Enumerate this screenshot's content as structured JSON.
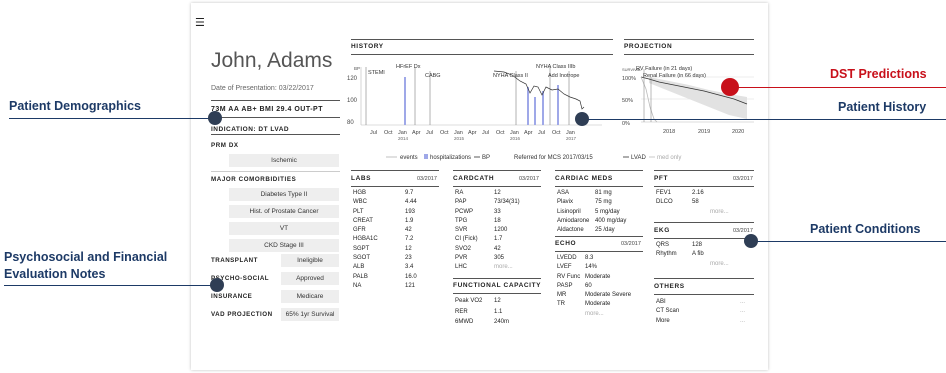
{
  "menu_icon": "hamburger-menu-icon",
  "patient": {
    "name": "John, Adams",
    "presentation_date": "Date of Presentation: 03/22/2017",
    "demographics": "73M  AA  AB+  BMI 29.4  OUT-PT",
    "indication": "INDICATION: DT LVAD"
  },
  "left": {
    "prm_dx_title": "PRM DX",
    "prm_dx": "Ischemic",
    "comorb_title": "MAJOR COMORBIDITIES",
    "comorbidities": [
      "Diabetes Type II",
      "Hist. of Prostate Cancer",
      "VT",
      "CKD Stage III"
    ],
    "eval": [
      {
        "label": "TRANSPLANT",
        "value": "Ineligible"
      },
      {
        "label": "PSYCHO-SOCIAL",
        "value": "Approved"
      },
      {
        "label": "INSURANCE",
        "value": "Medicare"
      },
      {
        "label": "VAD PROJECTION",
        "value": "65% 1yr Survival"
      }
    ]
  },
  "history": {
    "title": "HISTORY",
    "y_label": "BP",
    "y_ticks": [
      "120",
      "100",
      "80"
    ],
    "x_ticks": [
      "Jul",
      "Oct",
      "Jan",
      "Apr",
      "Jul",
      "Oct",
      "Jan",
      "Apr",
      "Jul",
      "Oct",
      "Jan",
      "Apr",
      "Jul",
      "Oct",
      "Jan"
    ],
    "years": [
      "2014",
      "2015",
      "2016",
      "2017"
    ],
    "events": [
      "STEMI",
      "HFrEF Dx",
      "CABG",
      "NYHA Class II",
      "NYHA Class IIIb",
      "Add Inotrope"
    ],
    "legend_events": "events",
    "legend_hosp": "hospitalizations",
    "legend_bp": "BP",
    "referred": "Referred for MCS 2017/03/15"
  },
  "projection": {
    "title": "PROJECTION",
    "y_label": "SURVIVAL",
    "y_ticks": [
      "100%",
      "50%",
      "0%"
    ],
    "x_ticks": [
      "2018",
      "2019",
      "2020"
    ],
    "rv_failure": "RV Failure (in 21 days)",
    "renal_failure": "Renal Failure (in 66 days)",
    "legend_lvad": "LVAD",
    "legend_med": "med only"
  },
  "labs": {
    "title": "LABS",
    "date": "03/2017",
    "rows": [
      [
        "HGB",
        "9.7"
      ],
      [
        "WBC",
        "4.44"
      ],
      [
        "PLT",
        "193"
      ],
      [
        "CREAT",
        "1.9"
      ],
      [
        "GFR",
        "42"
      ],
      [
        "HGBA1C",
        "7.2"
      ],
      [
        "SGPT",
        "12"
      ],
      [
        "SGOT",
        "23"
      ],
      [
        "ALB",
        "3.4"
      ],
      [
        "PALB",
        "16.0"
      ],
      [
        "NA",
        "121"
      ]
    ]
  },
  "cardcath": {
    "title": "CARDCATH",
    "date": "03/2017",
    "rows": [
      [
        "RA",
        "12"
      ],
      [
        "PAP",
        "73/34(31)"
      ],
      [
        "PCWP",
        "33"
      ],
      [
        "TPG",
        "18"
      ],
      [
        "SVR",
        "1200"
      ],
      [
        "CI (Fick)",
        "1.7"
      ],
      [
        "SVO2",
        "42"
      ],
      [
        "PVR",
        "305"
      ],
      [
        "LHC",
        "more..."
      ]
    ]
  },
  "functional": {
    "title": "FUNCTIONAL CAPACITY",
    "rows": [
      [
        "Peak VO2",
        "12"
      ],
      [
        "RER",
        "1.1"
      ],
      [
        "6MWD",
        "240m"
      ]
    ]
  },
  "meds": {
    "title": "CARDIAC MEDS",
    "rows": [
      [
        "ASA",
        "81 mg"
      ],
      [
        "Plavix",
        "75 mg"
      ],
      [
        "Lisinopril",
        "5 mg/day"
      ],
      [
        "Amiodarone",
        "400 mg/day"
      ],
      [
        "Aldactone",
        "25 /day"
      ]
    ]
  },
  "echo": {
    "title": "ECHO",
    "date": "03/2017",
    "rows": [
      [
        "LVEDD",
        "8.3"
      ],
      [
        "LVEF",
        "14%"
      ],
      [
        "RV Func",
        "Moderate"
      ],
      [
        "PASP",
        "60"
      ],
      [
        "MR",
        "Moderate Severe"
      ],
      [
        "TR",
        "Moderate"
      ]
    ],
    "more": "more..."
  },
  "pft": {
    "title": "PFT",
    "date": "03/2017",
    "rows": [
      [
        "FEV1",
        "2.16"
      ],
      [
        "DLCO",
        "58"
      ]
    ],
    "more": "more..."
  },
  "ekg": {
    "title": "EKG",
    "date": "03/2017",
    "rows": [
      [
        "QRS",
        "128"
      ],
      [
        "Rhythm",
        "A fib"
      ]
    ],
    "more": "more..."
  },
  "others": {
    "title": "OTHERS",
    "rows": [
      [
        "ABI",
        "..."
      ],
      [
        "CT Scan",
        "..."
      ],
      [
        "More",
        "..."
      ]
    ]
  },
  "annotations": {
    "demographics": "Patient Demographics",
    "psychosocial_1": "Psychosocial and Financial",
    "psychosocial_2": "Evaluation Notes",
    "dst": "DST Predictions",
    "history": "Patient History",
    "conditions": "Patient Conditions"
  },
  "colors": {
    "annotation": "#1d3a66",
    "dst": "#c8101a",
    "hosp": "#9fa8e8"
  }
}
